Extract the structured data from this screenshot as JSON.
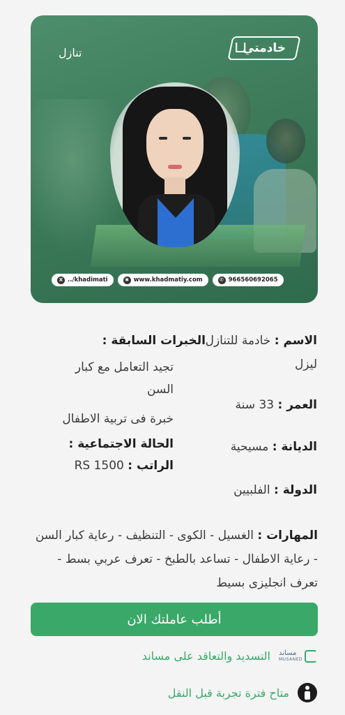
{
  "hero": {
    "tag": "تنازل",
    "logo_text": "خادمتي",
    "contacts": [
      {
        "icon": "x-icon",
        "text": "../khadimati"
      },
      {
        "icon": "globe-icon",
        "text": "www.khadmatiy.com"
      },
      {
        "icon": "phone-icon",
        "text": "966560692065"
      }
    ]
  },
  "details": {
    "name_label": "الاسم :",
    "name_value": "خادمة للتنازل",
    "name_continued": "ليزل",
    "experience_label": "الخبرات السابقة :",
    "experience_1_line1": "تجيد التعامل مع كبار",
    "experience_1_line2": "السن",
    "experience_2": "خبرة فى تربية الاطفال",
    "social_status_label": "الحالة الاجتماعية :",
    "age_label": "العمر :",
    "age_value": "33 سنة",
    "salary_label": "الراتب :",
    "salary_value": "RS 1500",
    "religion_label": "الديانة :",
    "religion_value": "مسيحية",
    "country_label": "الدولة :",
    "country_value": "الفلبيين",
    "skills_label": "المهارات :",
    "skills_value": "الغسيل - الكوى - التنظيف - رعاية كبار السن - رعاية الاطفال - تساعد بالطبخ - تعرف عربي بسط - تعرف انجليزى بسيط"
  },
  "cta": {
    "label": "أطلب عاملتك الان"
  },
  "features": {
    "musaned": "التسديد والتعاقد على مساند",
    "musaned_logo_ar": "مساند",
    "musaned_logo_en": "MUSANED",
    "trial": "متاح فترة تجربة قبل النقل"
  },
  "colors": {
    "brand_green": "#3aa868",
    "hero_green": "#3d7b5a"
  }
}
